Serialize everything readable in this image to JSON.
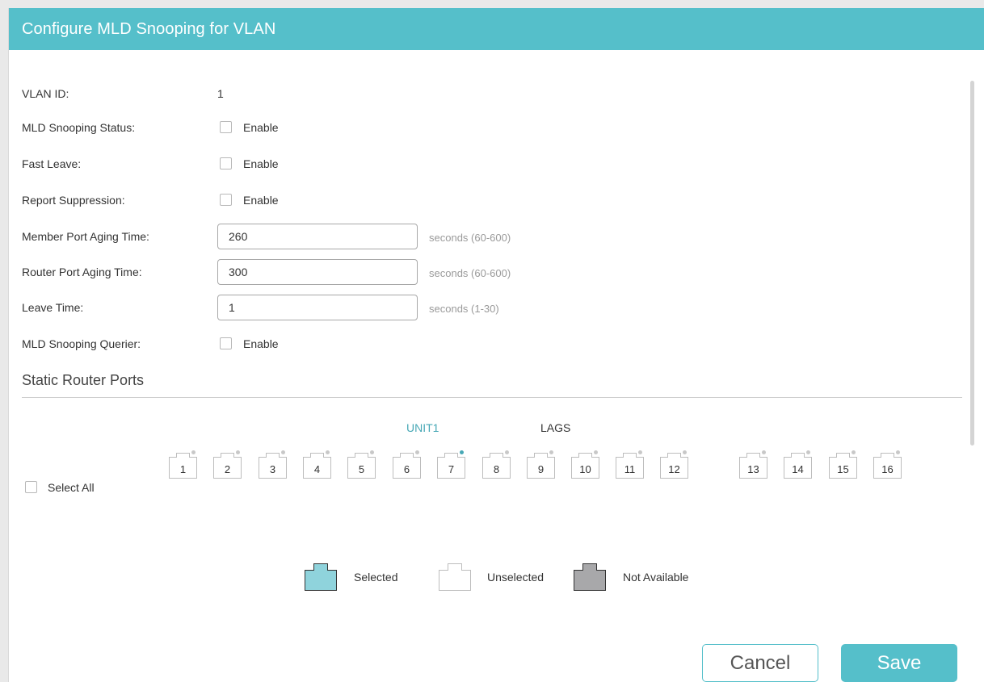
{
  "dialog": {
    "title": "Configure MLD Snooping for VLAN"
  },
  "form": {
    "vlan_id_label": "VLAN ID:",
    "vlan_id_value": "1",
    "mld_status_label": "MLD Snooping Status:",
    "mld_status_option": "Enable",
    "fast_leave_label": "Fast Leave:",
    "fast_leave_option": "Enable",
    "report_suppression_label": "Report Suppression:",
    "report_suppression_option": "Enable",
    "member_aging_label": "Member Port Aging Time:",
    "member_aging_value": "260",
    "member_aging_hint": "seconds (60-600)",
    "router_aging_label": "Router Port Aging Time:",
    "router_aging_value": "300",
    "router_aging_hint": "seconds (60-600)",
    "leave_time_label": "Leave Time:",
    "leave_time_value": "1",
    "leave_time_hint": "seconds (1-30)",
    "querier_label": "MLD Snooping Querier:",
    "querier_option": "Enable"
  },
  "static_router_ports": {
    "section_title": "Static Router Ports",
    "unit_tab": "UNIT1",
    "lags_tab": "LAGS",
    "select_all_label": "Select All",
    "unit_ports": [
      "1",
      "2",
      "3",
      "4",
      "5",
      "6",
      "7",
      "8",
      "9",
      "10",
      "11",
      "12"
    ],
    "lag_ports": [
      "13",
      "14",
      "15",
      "16"
    ],
    "active_link_port": "7"
  },
  "legend": {
    "selected": "Selected",
    "unselected": "Unselected",
    "not_available": "Not Available"
  },
  "buttons": {
    "cancel": "Cancel",
    "save": "Save"
  },
  "colors": {
    "accent": "#55bfca",
    "selected_fill": "#8fd3dc",
    "not_available_fill": "#a8a8aa"
  }
}
